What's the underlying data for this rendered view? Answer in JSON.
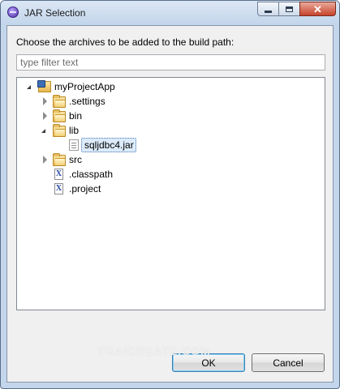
{
  "window": {
    "title": "JAR Selection",
    "controls": {
      "minimize": "minimize-icon",
      "maximize": "maximize-icon",
      "close": "close-icon"
    }
  },
  "prompt": "Choose the archives to be added to the build path:",
  "filter": {
    "placeholder": "type filter text",
    "value": ""
  },
  "tree": {
    "items": [
      {
        "label": "myProjectApp",
        "icon": "project-folder-icon",
        "expanded": true
      },
      {
        "label": ".settings",
        "icon": "folder-icon",
        "expanded": false
      },
      {
        "label": "bin",
        "icon": "folder-icon",
        "expanded": false
      },
      {
        "label": "lib",
        "icon": "folder-icon",
        "expanded": true
      },
      {
        "label": "sqljdbc4.jar",
        "icon": "jar-file-icon",
        "selected": true
      },
      {
        "label": "src",
        "icon": "folder-icon",
        "expanded": false
      },
      {
        "label": ".classpath",
        "icon": "xml-file-icon"
      },
      {
        "label": ".project",
        "icon": "xml-file-icon"
      }
    ]
  },
  "buttons": {
    "ok": "OK",
    "cancel": "Cancel"
  },
  "watermark": "THAICREATE.COM",
  "colors": {
    "title_bar": "#c2d5eb",
    "selection": "#dcebfb",
    "close_button": "#c7432a"
  }
}
